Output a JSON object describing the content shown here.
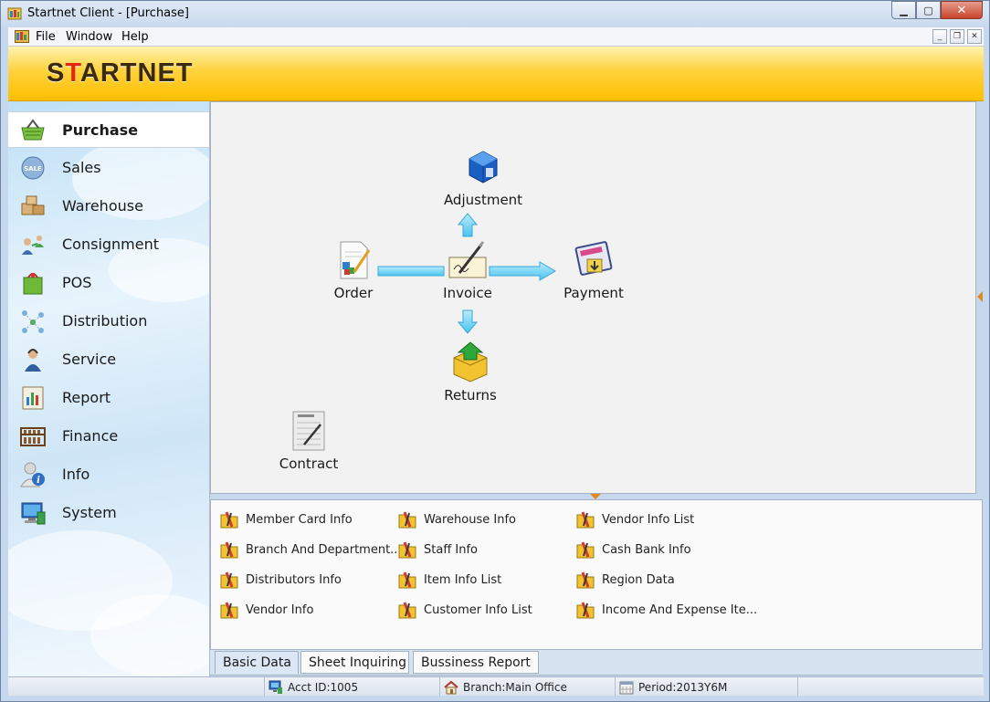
{
  "window": {
    "title": "Startnet Client - [Purchase]",
    "min_symbol": "▁",
    "max_symbol": "▢",
    "close_symbol": "✕"
  },
  "menu": {
    "file": "File",
    "window": "Window",
    "help": "Help",
    "mdi_min": "_",
    "mdi_restore": "❐",
    "mdi_close": "✕"
  },
  "banner": {
    "logo_prefix": "S",
    "logo_accent": "T",
    "logo_rest": "ARTNET",
    "accent_color": "#e02a10"
  },
  "sidebar": {
    "items": [
      {
        "label": "Purchase",
        "icon": "shopping-basket-icon",
        "active": true
      },
      {
        "label": "Sales",
        "icon": "sale-badge-icon",
        "active": false
      },
      {
        "label": "Warehouse",
        "icon": "boxes-icon",
        "active": false
      },
      {
        "label": "Consignment",
        "icon": "people-transfer-icon",
        "active": false
      },
      {
        "label": "POS",
        "icon": "shopping-bag-icon",
        "active": false
      },
      {
        "label": "Distribution",
        "icon": "network-dots-icon",
        "active": false
      },
      {
        "label": "Service",
        "icon": "service-agent-icon",
        "active": false
      },
      {
        "label": "Report",
        "icon": "report-chart-icon",
        "active": false
      },
      {
        "label": "Finance",
        "icon": "abacus-icon",
        "active": false
      },
      {
        "label": "Info",
        "icon": "user-info-icon",
        "active": false
      },
      {
        "label": "System",
        "icon": "computer-system-icon",
        "active": false
      }
    ]
  },
  "flow": {
    "nodes": {
      "adjustment": "Adjustment",
      "order": "Order",
      "invoice": "Invoice",
      "payment": "Payment",
      "returns": "Returns",
      "contract": "Contract"
    }
  },
  "basic_data": {
    "items": [
      [
        "Member Card Info",
        "Branch And Department...",
        "Distributors Info",
        "Vendor Info"
      ],
      [
        "Warehouse Info",
        "Staff Info",
        "Item Info List",
        "Customer Info List"
      ],
      [
        "Vendor Info List",
        "Cash Bank Info",
        "Region Data",
        "Income And Expense Ite..."
      ]
    ]
  },
  "tabs": {
    "basic": "Basic Data",
    "sheet": "Sheet Inquiring",
    "report": "Bussiness Report"
  },
  "status": {
    "acct": "Acct ID:1005",
    "branch": "Branch:Main Office",
    "period": "Period:2013Y6M"
  }
}
